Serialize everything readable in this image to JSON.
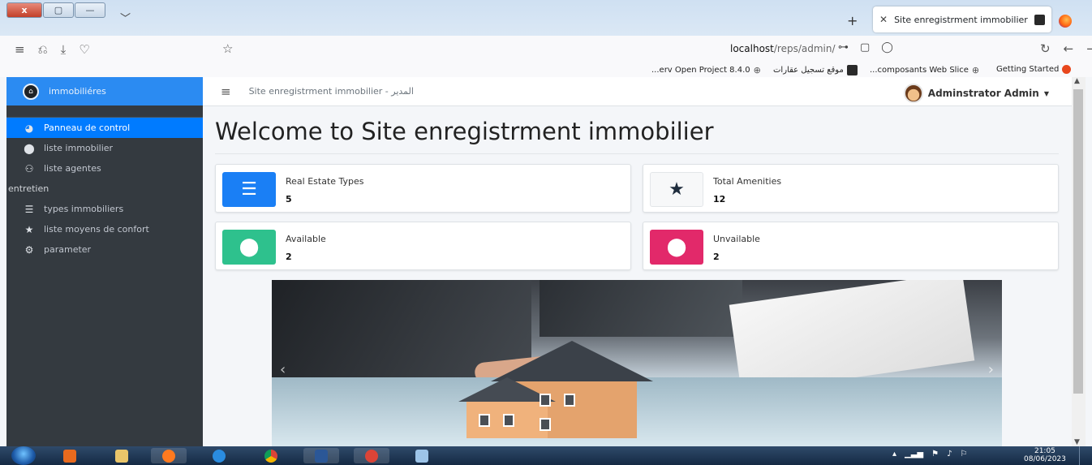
{
  "browser": {
    "tab_title": "Site enregistrment immobilier",
    "url_host": "localhost",
    "url_path": "/reps/admin/",
    "bookmarks": [
      "Getting Started",
      "...composants Web Slice",
      "موقع تسجيل عقارات",
      "...erv Open Project 8.4.0"
    ]
  },
  "sidebar": {
    "brand": "immobiliéres",
    "items": [
      {
        "label": "Panneau de control",
        "icon": "dashboard-icon",
        "active": true
      },
      {
        "label": "liste immobilier",
        "icon": "map-marker-icon",
        "active": false
      },
      {
        "label": "liste agentes",
        "icon": "users-icon",
        "active": false
      }
    ],
    "section_header": "entretien",
    "items2": [
      {
        "label": "types immobiliers",
        "icon": "list-icon"
      },
      {
        "label": "liste moyens de confort",
        "icon": "star-icon"
      },
      {
        "label": "parameter",
        "icon": "cogs-icon"
      }
    ]
  },
  "topbar": {
    "breadcrumb": "Site enregistrment immobilier - المدير",
    "user": "Adminstrator Admin"
  },
  "main": {
    "title": "Welcome to Site enregistrment immobilier",
    "cards": [
      {
        "label": "Real Estate Types",
        "value": "5",
        "color": "#1a7ff5",
        "icon": "list-icon"
      },
      {
        "label": "Total Amenities",
        "value": "12",
        "color": "#f7f8f9",
        "icon": "star-icon"
      },
      {
        "label": "Available",
        "value": "2",
        "color": "#2ec18d",
        "icon": "map-marker-icon"
      },
      {
        "label": "Unvailable",
        "value": "2",
        "color": "#e2296a",
        "icon": "map-marker-icon"
      }
    ]
  },
  "taskbar": {
    "time": "21:05",
    "date": "08/06/2023"
  }
}
